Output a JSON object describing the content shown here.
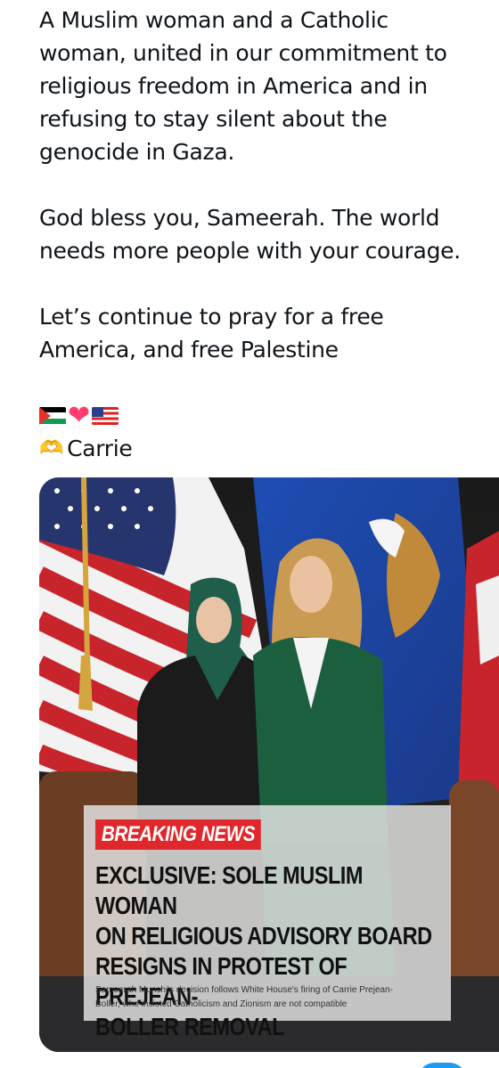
{
  "post": {
    "paragraphs": [
      "A Muslim woman and a Catholic\nwoman, united in our commitment to\nreligious freedom in America and in\nrefusing to stay silent about the\ngenocide in Gaza.",
      "God bless you, Sameerah. The world\nneeds more people with your courage.",
      "Let’s continue to pray for a free\nAmerica, and free Palestine"
    ],
    "emoji_icons": [
      "palestine-flag",
      "heart",
      "us-flag"
    ],
    "signature_icon": "heart-hands",
    "signature": "Carrie"
  },
  "media": {
    "breaking_label": "BREAKING NEWS",
    "headline": "EXCLUSIVE: SOLE MUSLIM WOMAN\nON RELIGIOUS ADVISORY BOARD\nRESIGNS IN PROTEST OF PREJEAN-\nBOLLER REMOVAL",
    "subhead": "Sameerah Munshi's decision follows White House's firing of Carrie Prejean-\nBoller, who insisted Catholicism and Zionism are not compatible"
  },
  "colors": {
    "text": "#0f1419",
    "breaking_red": "#e0282c",
    "link_blue": "#1d9bf0"
  }
}
